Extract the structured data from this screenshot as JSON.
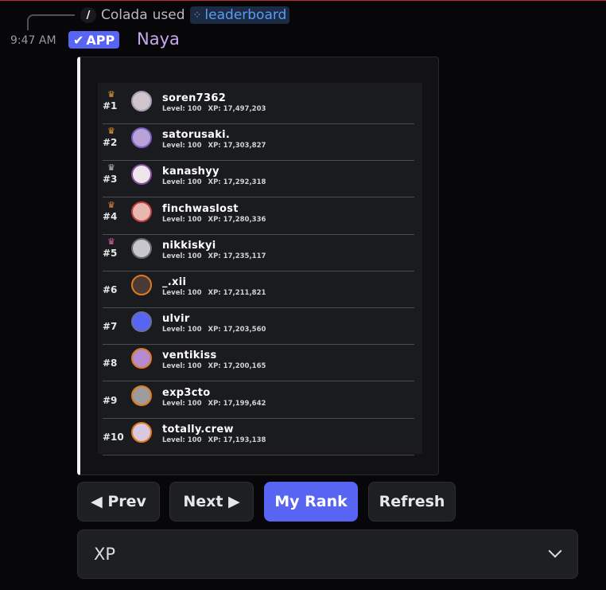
{
  "reply": {
    "slash": "/",
    "user": "Colada",
    "verb": "used",
    "command": "leaderboard"
  },
  "message": {
    "timestamp": "9:47 AM",
    "app_badge": "APP",
    "username": "Naya"
  },
  "leaderboard": [
    {
      "rank": "#1",
      "name": "soren7362",
      "level_label": "Level: 100",
      "xp_label": "XP: 17,497,203",
      "crown_color": "#e9a33e",
      "avatar_color": "#cfc6cc",
      "ring_color": "#a99bb5"
    },
    {
      "rank": "#2",
      "name": "satorusaki.",
      "level_label": "Level: 100",
      "xp_label": "XP: 17,303,827",
      "crown_color": "#f0a13a",
      "avatar_color": "#b9a2d8",
      "ring_color": "#7a5fc0"
    },
    {
      "rank": "#3",
      "name": "kanashyy",
      "level_label": "Level: 100",
      "xp_label": "XP: 17,292,318",
      "crown_color": "#c4c4c8",
      "avatar_color": "#efe6ec",
      "ring_color": "#8b4fa0"
    },
    {
      "rank": "#4",
      "name": "finchwaslost",
      "level_label": "Level: 100",
      "xp_label": "XP: 17,280,336",
      "crown_color": "#e9883e",
      "avatar_color": "#e8b8b0",
      "ring_color": "#c04040"
    },
    {
      "rank": "#5",
      "name": "nikkiskyi",
      "level_label": "Level: 100",
      "xp_label": "XP: 17,235,117",
      "crown_color": "#e66ab0",
      "avatar_color": "#c8c8cc",
      "ring_color": "#666a70"
    },
    {
      "rank": "#6",
      "name": "_.xii",
      "level_label": "Level: 100",
      "xp_label": "XP: 17,211,821",
      "crown_color": "",
      "avatar_color": "#4a3a36",
      "ring_color": "#e07a1a"
    },
    {
      "rank": "#7",
      "name": "ulvir",
      "level_label": "Level: 100",
      "xp_label": "XP: 17,203,560",
      "crown_color": "",
      "avatar_color": "#5865f2",
      "ring_color": "#6a6fa0"
    },
    {
      "rank": "#8",
      "name": "ventikiss",
      "level_label": "Level: 100",
      "xp_label": "XP: 17,200,165",
      "crown_color": "",
      "avatar_color": "#b48ad0",
      "ring_color": "#e07a1a"
    },
    {
      "rank": "#9",
      "name": "exp3cto",
      "level_label": "Level: 100",
      "xp_label": "XP: 17,199,642",
      "crown_color": "",
      "avatar_color": "#9c9c9c",
      "ring_color": "#e07a1a"
    },
    {
      "rank": "#10",
      "name": "totally.crew",
      "level_label": "Level: 100",
      "xp_label": "XP: 17,193,138",
      "crown_color": "",
      "avatar_color": "#d8c8e0",
      "ring_color": "#e07a1a"
    }
  ],
  "buttons": {
    "prev": "◀ Prev",
    "next": "Next ▶",
    "my_rank": "My Rank",
    "refresh": "Refresh"
  },
  "select": {
    "value": "XP"
  },
  "colors": {
    "accent": "#5865f2",
    "embed_border": "#f2f3f5",
    "username": "#c9a8f0"
  }
}
